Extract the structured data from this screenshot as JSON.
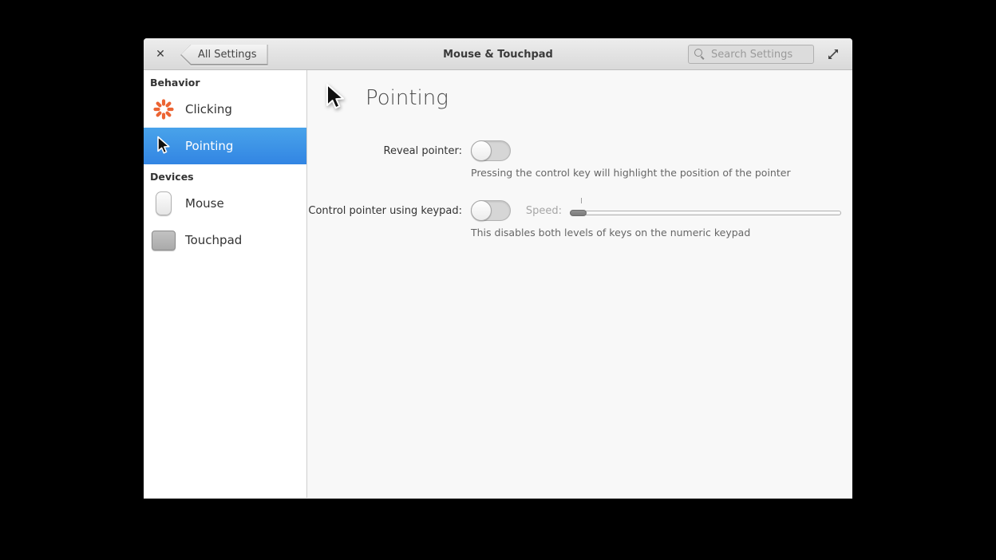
{
  "window": {
    "header": {
      "back_button_label": "All Settings",
      "title": "Mouse & Touchpad",
      "search_placeholder": "Search Settings"
    },
    "sidebar": {
      "sections": [
        {
          "label": "Behavior",
          "items": [
            {
              "label": "Clicking",
              "icon": "clicking-burst-icon",
              "selected": false
            },
            {
              "label": "Pointing",
              "icon": "pointer-cursor-icon",
              "selected": true
            }
          ]
        },
        {
          "label": "Devices",
          "items": [
            {
              "label": "Mouse",
              "icon": "mouse-icon",
              "selected": false
            },
            {
              "label": "Touchpad",
              "icon": "touchpad-icon",
              "selected": false
            }
          ]
        }
      ]
    },
    "content": {
      "title": "Pointing",
      "rows": [
        {
          "label": "Reveal pointer:",
          "toggle_state": "off",
          "description": "Pressing the control key will highlight the position of the pointer"
        },
        {
          "label": "Control pointer using keypad:",
          "toggle_state": "off",
          "speed_label": "Speed:",
          "slider": {
            "value_percent": 2,
            "enabled": false,
            "tick_percent": 4
          },
          "description": "This disables both levels of keys on the numeric keypad"
        }
      ]
    },
    "icons": {
      "close": "✕",
      "search": "magnifier",
      "expand": "resize-diagonal",
      "clicking": "orange-burst",
      "pointing": "cursor-arrow",
      "mouse": "mouse-body",
      "touchpad": "touchpad-square"
    },
    "colors": {
      "selection_blue": "#3689e6",
      "accent_orange": "#ec6433",
      "header_gray": "#e0e0e0",
      "content_bg": "#f8f8f8"
    }
  }
}
